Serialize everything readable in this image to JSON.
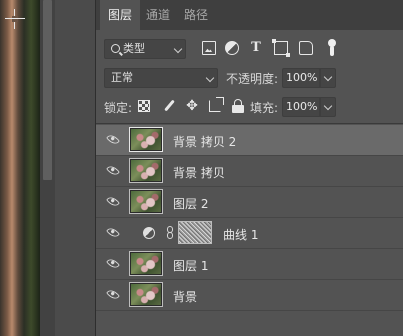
{
  "tabs": [
    {
      "label": "图层",
      "active": true
    },
    {
      "label": "通道",
      "active": false
    },
    {
      "label": "路径",
      "active": false
    }
  ],
  "filter": {
    "kind_label": "类型",
    "icons": [
      "image-filter-icon",
      "adjustment-filter-icon",
      "type-filter-icon",
      "shape-filter-icon",
      "smart-object-filter-icon",
      "filter-toggle-icon"
    ]
  },
  "blend": {
    "mode": "正常",
    "opacity_label": "不透明度:",
    "opacity_value": "100%"
  },
  "lock": {
    "label": "锁定:",
    "fill_label": "填充:",
    "fill_value": "100%",
    "icons": [
      "lock-transparent-pixels-icon",
      "lock-image-pixels-icon",
      "lock-position-icon",
      "lock-artboard-icon",
      "lock-all-icon"
    ]
  },
  "layers": [
    {
      "name": "背景 拷贝 2",
      "selected": true,
      "type": "image",
      "visible": true
    },
    {
      "name": "背景 拷贝",
      "selected": false,
      "type": "image",
      "visible": true
    },
    {
      "name": "图层 2",
      "selected": false,
      "type": "image",
      "visible": true
    },
    {
      "name": "曲线 1",
      "selected": false,
      "type": "adjustment",
      "visible": true
    },
    {
      "name": "图层 1",
      "selected": false,
      "type": "image",
      "visible": true
    },
    {
      "name": "背景",
      "selected": false,
      "type": "image",
      "visible": true
    }
  ],
  "colors": {
    "panel_bg": "#535353",
    "tab_bar_bg": "#3f3f3f",
    "selected_row": "#6a6a6a"
  }
}
